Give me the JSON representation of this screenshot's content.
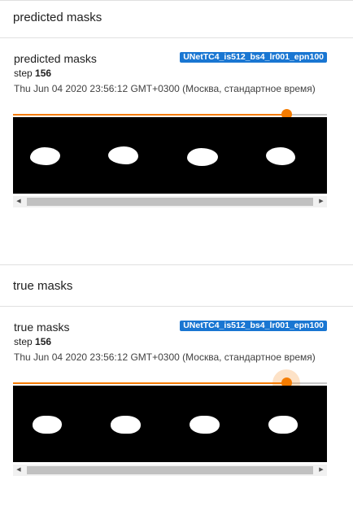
{
  "sections": [
    {
      "header": "predicted masks",
      "card": {
        "title": "predicted masks",
        "run_label": "UNetTC4_is512_bs4_lr001_epn100",
        "step_prefix": "step",
        "step_value": "156",
        "timestamp": "Thu Jun 04 2020 23:56:12 GMT+0300 (Москва, стандартное время)",
        "slider_fraction": 0.87,
        "image_alt": "predicted mask grid"
      }
    },
    {
      "header": "true masks",
      "card": {
        "title": "true masks",
        "run_label": "UNetTC4_is512_bs4_lr001_epn100",
        "step_prefix": "step",
        "step_value": "156",
        "timestamp": "Thu Jun 04 2020 23:56:12 GMT+0300 (Москва, стандартное время)",
        "slider_fraction": 0.87,
        "slider_focused": true,
        "image_alt": "true mask grid"
      }
    }
  ],
  "colors": {
    "accent": "#f57c00",
    "run_chip": "#1976d2",
    "divider": "#e0e0e0"
  },
  "icons": {
    "scroll_left": "scroll-left-arrow-icon",
    "scroll_right": "scroll-right-arrow-icon"
  }
}
